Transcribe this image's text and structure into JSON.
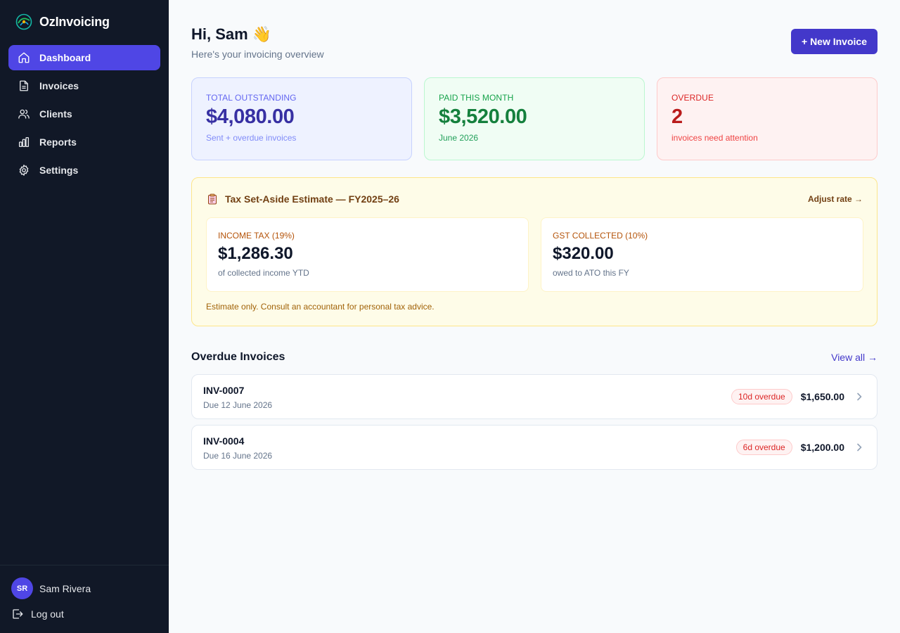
{
  "app": {
    "name": "OzInvoicing"
  },
  "sidebar": {
    "items": [
      {
        "label": "Dashboard",
        "icon": "home-icon",
        "active": true
      },
      {
        "label": "Invoices",
        "icon": "document-icon"
      },
      {
        "label": "Clients",
        "icon": "users-icon"
      },
      {
        "label": "Reports",
        "icon": "bar-chart-icon"
      },
      {
        "label": "Settings",
        "icon": "gear-icon"
      }
    ],
    "user": {
      "initials": "SR",
      "name": "Sam Rivera"
    },
    "logout_label": "Log out"
  },
  "header": {
    "greeting": "Hi, Sam 👋",
    "subtitle": "Here's your invoicing overview",
    "new_invoice_label": "+ New Invoice"
  },
  "stats": {
    "outstanding": {
      "label": "Total Outstanding",
      "value": "$4,080.00",
      "sub": "Sent + overdue invoices"
    },
    "paid": {
      "label": "Paid This Month",
      "value": "$3,520.00",
      "sub": "June 2026"
    },
    "overdue": {
      "label": "Overdue",
      "value": "2",
      "sub": "invoices need attention"
    }
  },
  "tax": {
    "title": "Tax Set-Aside Estimate — FY2025–26",
    "adjust_label": "Adjust rate →",
    "income": {
      "label": "Income Tax (19%)",
      "value": "$1,286.30",
      "sub": "of collected income YTD"
    },
    "gst": {
      "label": "GST Collected (10%)",
      "value": "$320.00",
      "sub": "owed to ATO this FY"
    },
    "note": "Estimate only. Consult an accountant for personal tax advice."
  },
  "overdue_section": {
    "title": "Overdue Invoices",
    "view_all_label": "View all →",
    "invoices": [
      {
        "id": "INV-0007",
        "due": "Due 12 June 2026",
        "badge": "10d overdue",
        "amount": "$1,650.00"
      },
      {
        "id": "INV-0004",
        "due": "Due 16 June 2026",
        "badge": "6d overdue",
        "amount": "$1,200.00"
      }
    ]
  },
  "colors": {
    "sidebar_bg": "#111827",
    "accent": "#4f46e5",
    "primary_button": "#4338ca"
  }
}
